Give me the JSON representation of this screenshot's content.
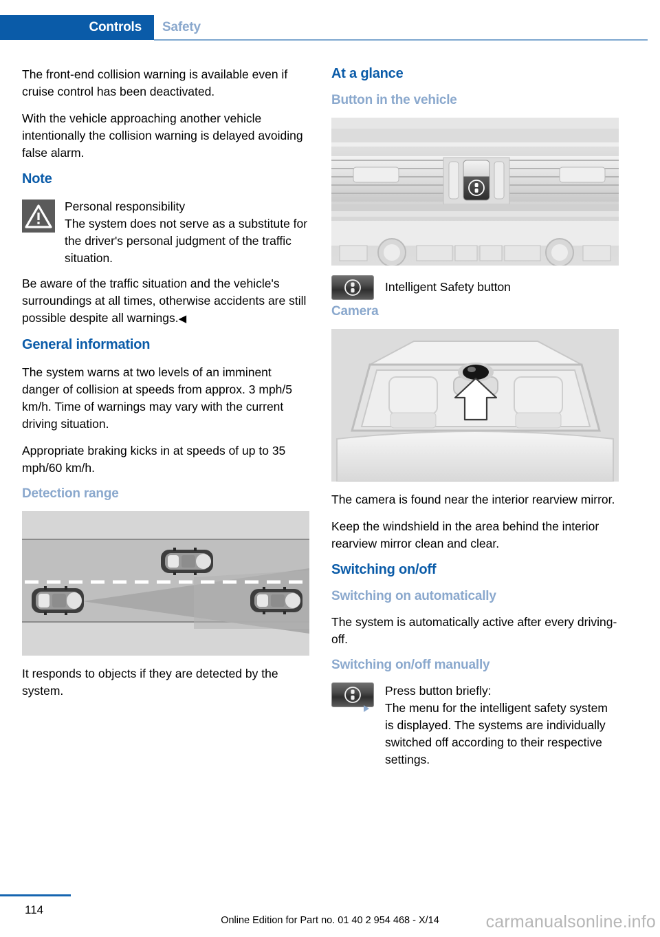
{
  "header": {
    "active_tab": "Controls",
    "inactive_tab": "Safety",
    "accent_color": "#0a5ba8",
    "muted_heading_color": "#8aa8cd"
  },
  "left_column": {
    "para_1": "The front-end collision warning is available even if cruise control has been deactivated.",
    "para_2": "With the vehicle approaching another vehicle intentionally the collision warning is delayed avoiding false alarm.",
    "note_heading": "Note",
    "note_title": "Personal responsibility",
    "note_body_1": "The system does not serve as a substitute for the driver's personal judgment of the traffic situation.",
    "note_body_2": "Be aware of the traffic situation and the vehicle's surroundings at all times, otherwise accidents are still possible despite all warnings.",
    "note_endmark": "◀",
    "general_heading": "General information",
    "general_para_1": "The system warns at two levels of an imminent danger of collision at speeds from approx. 3 mph/5 km/h. Time of warnings may vary with the current driving situation.",
    "general_para_2": "Appropriate braking kicks in at speeds of up to 35 mph/60 km/h.",
    "detection_heading": "Detection range",
    "detection_caption": "It responds to objects if they are detected by the system.",
    "detection_figure_alt": "detection-range-diagram"
  },
  "right_column": {
    "at_a_glance_heading": "At a glance",
    "button_heading": "Button in the vehicle",
    "button_figure_alt": "dashboard-button-photo",
    "button_caption": "Intelligent Safety button",
    "camera_heading": "Camera",
    "camera_figure_alt": "windshield-camera-photo",
    "camera_para_1": "The camera is found near the interior rearview mirror.",
    "camera_para_2": "Keep the windshield in the area behind the interior rearview mirror clean and clear.",
    "switching_heading": "Switching on/off",
    "auto_heading": "Switching on automatically",
    "auto_para": "The system is automatically active after every driving-off.",
    "manual_heading": "Switching on/off manually",
    "manual_label": "Press button briefly:",
    "manual_bullets": [
      "The menu for the intelligent safety system is displayed. The systems are individually switched off according to their respective settings."
    ]
  },
  "footer": {
    "page_number": "114",
    "edition_text": "Online Edition for Part no. 01 40 2 954 468 - X/14",
    "watermark": "carmanualsonline.info"
  },
  "icons": {
    "warning": "warning-triangle-icon",
    "intelligent_safety": "intelligent-safety-button-icon",
    "bullet": "triangle-bullet-icon"
  }
}
